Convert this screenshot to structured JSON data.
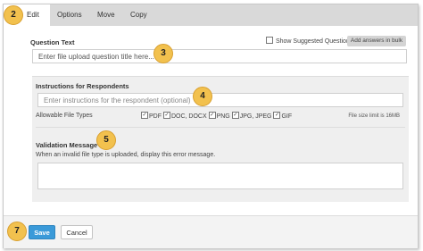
{
  "tabs": [
    "Edit",
    "Options",
    "Move",
    "Copy"
  ],
  "callouts": {
    "c2": "2",
    "c3": "3",
    "c4": "4",
    "c5": "5",
    "c7": "7"
  },
  "question": {
    "label": "Question Text",
    "show_suggested_label": "Show Suggested Questions",
    "bulk_button": "Add answers in bulk",
    "placeholder": "Enter file upload question title here..."
  },
  "instructions": {
    "label": "Instructions for Respondents",
    "placeholder": "Enter instructions for the respondent (optional)"
  },
  "file_types": {
    "label": "Allowable File Types",
    "options": [
      "PDF",
      "DOC, DOCX",
      "PNG",
      "JPG, JPEG",
      "GIF"
    ],
    "size_limit": "File size limit is 16MB"
  },
  "validation": {
    "label": "Validation Message",
    "message": "When an invalid file type is uploaded, display this error message."
  },
  "footer": {
    "save": "Save",
    "cancel": "Cancel"
  },
  "colors": {
    "accent": "#3a9ad9",
    "callout": "#f2c14e"
  }
}
